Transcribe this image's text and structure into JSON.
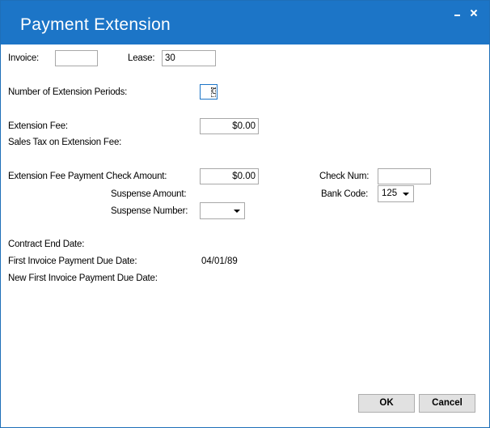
{
  "window": {
    "title": "Payment Extension"
  },
  "form": {
    "invoice_label": "Invoice:",
    "invoice_value": "",
    "lease_label": "Lease:",
    "lease_value": "30",
    "extension_periods_label": "Number of Extension Periods:",
    "extension_periods_value": "0",
    "extension_fee_label": "Extension Fee:",
    "extension_fee_value": "$0.00",
    "sales_tax_label": "Sales Tax on Extension Fee:",
    "check_amount_label": "Extension Fee Payment Check Amount:",
    "check_amount_value": "$0.00",
    "check_num_label": "Check Num:",
    "check_num_value": "",
    "suspense_amount_label": "Suspense Amount:",
    "bank_code_label": "Bank Code:",
    "bank_code_value": "125",
    "suspense_number_label": "Suspense Number:",
    "suspense_number_value": "",
    "contract_end_label": "Contract End Date:",
    "first_due_label": "First Invoice Payment Due Date:",
    "first_due_value": "04/01/89",
    "new_first_due_label": "New First Invoice Payment Due Date:"
  },
  "buttons": {
    "ok": "OK",
    "cancel": "Cancel"
  }
}
